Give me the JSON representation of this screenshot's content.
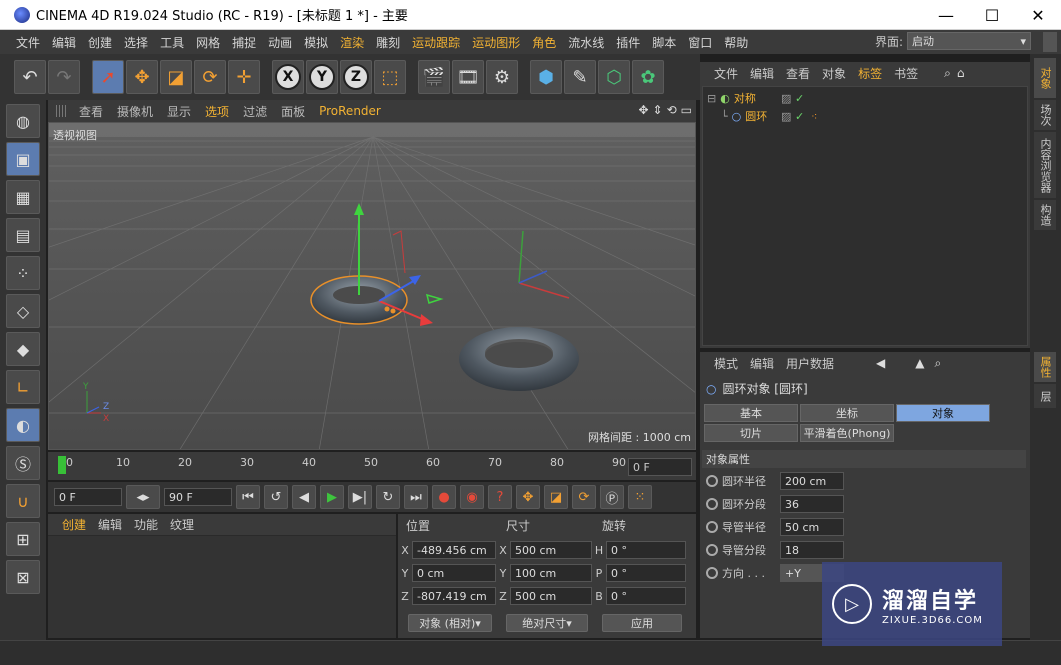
{
  "titlebar": {
    "title": "CINEMA 4D R19.024 Studio (RC - R19) - [未标题 1 *] - 主要",
    "min": "—",
    "max": "☐",
    "close": "✕"
  },
  "menubar": {
    "items": [
      "文件",
      "编辑",
      "创建",
      "选择",
      "工具",
      "网格",
      "捕捉",
      "动画",
      "模拟",
      "渲染",
      "雕刻",
      "运动跟踪",
      "运动图形",
      "角色",
      "流水线",
      "插件",
      "脚本",
      "窗口",
      "帮助"
    ],
    "layout_label": "界面:",
    "layout_value": "启动"
  },
  "viewport": {
    "menu": [
      "查看",
      "摄像机",
      "显示",
      "选项",
      "过滤",
      "面板",
      "ProRender"
    ],
    "label": "透视视图",
    "grid_info": "网格间距 : 1000 cm",
    "axis_labels": {
      "y": "Y",
      "z": "Z",
      "x": "X"
    }
  },
  "timeline": {
    "ticks": [
      "0",
      "10",
      "20",
      "30",
      "40",
      "50",
      "60",
      "70",
      "80",
      "90"
    ],
    "current_frame": "0 F"
  },
  "transport": {
    "start": "0 F",
    "end": "90 F"
  },
  "material_manager": {
    "menu": [
      "创建",
      "编辑",
      "功能",
      "纹理"
    ]
  },
  "coordinates": {
    "headers": [
      "位置",
      "尺寸",
      "旋转"
    ],
    "rows": [
      {
        "axis": "X",
        "pos": "-489.456 cm",
        "size_axis": "X",
        "size": "500 cm",
        "rot_axis": "H",
        "rot": "0 °"
      },
      {
        "axis": "Y",
        "pos": "0 cm",
        "size_axis": "Y",
        "size": "100 cm",
        "rot_axis": "P",
        "rot": "0 °"
      },
      {
        "axis": "Z",
        "pos": "-807.419 cm",
        "size_axis": "Z",
        "size": "500 cm",
        "rot_axis": "B",
        "rot": "0 °"
      }
    ],
    "mode": "对象 (相对)",
    "size_mode": "绝对尺寸",
    "apply": "应用"
  },
  "object_manager": {
    "menu": [
      "文件",
      "编辑",
      "查看",
      "对象",
      "标签",
      "书签"
    ],
    "objects": [
      {
        "name": "对称"
      },
      {
        "name": "圆环"
      }
    ]
  },
  "attribute_manager": {
    "menu": [
      "模式",
      "编辑",
      "用户数据"
    ],
    "object_title": "圆环对象 [圆环]",
    "tabs": [
      "基本",
      "坐标",
      "对象",
      "切片",
      "平滑着色(Phong)"
    ],
    "section": "对象属性",
    "props": [
      {
        "label": "圆环半径",
        "value": "200 cm"
      },
      {
        "label": "圆环分段",
        "value": "36"
      },
      {
        "label": "导管半径",
        "value": "50 cm"
      },
      {
        "label": "导管分段",
        "value": "18"
      },
      {
        "label": "方向 . . .",
        "value": "+Y"
      }
    ]
  },
  "vtabs": [
    "对象",
    "场次",
    "内容浏览器",
    "构造",
    "属性",
    "层"
  ],
  "watermark": {
    "main": "溜溜自学",
    "sub": "ZIXUE.3D66.COM"
  },
  "colors": {
    "accent": "#f2b233",
    "active_tab": "#7ea6e0",
    "selection": "#e8902a"
  }
}
